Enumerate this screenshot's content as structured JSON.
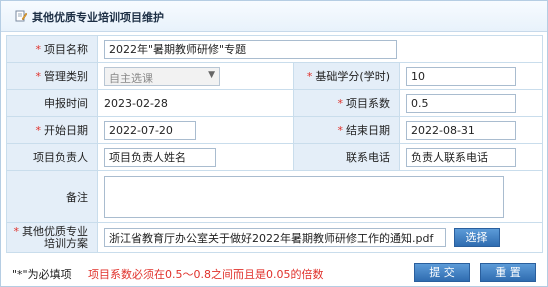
{
  "header": {
    "title": "其他优质专业培训项目维护"
  },
  "form": {
    "project_name": {
      "label": "项目名称",
      "value": "2022年\"暑期教师研修\"专题"
    },
    "management_category": {
      "label": "管理类别",
      "value": "自主选课"
    },
    "basic_credits": {
      "label": "基础学分(学时)",
      "value": "10"
    },
    "declare_time": {
      "label": "申报时间",
      "value": "2023-02-28"
    },
    "project_coefficient": {
      "label": "项目系数",
      "value": "0.5"
    },
    "start_date": {
      "label": "开始日期",
      "value": "2022-07-20"
    },
    "end_date": {
      "label": "结束日期",
      "value": "2022-08-31"
    },
    "project_leader": {
      "label": "项目负责人",
      "value": "项目负责人姓名"
    },
    "contact_phone": {
      "label": "联系电话",
      "value": "负责人联系电话"
    },
    "remarks": {
      "label": "备注",
      "value": ""
    },
    "training_plan": {
      "label_line1": "其他优质专业",
      "label_line2": "培训方案",
      "value": "浙江省教育厅办公室关于做好2022年暑期教师研修工作的通知.pdf",
      "select_button": "选择"
    }
  },
  "footer": {
    "required_note": "\"*\"为必填项",
    "coefficient_rule": "项目系数必须在0.5～0.8之间而且是0.05的倍数",
    "submit_label": "提 交",
    "reset_label": "重 置"
  },
  "icons": {
    "title_icon": "edit-document-icon"
  },
  "colors": {
    "required": "#e0312b",
    "label_bg": "#e4eef8",
    "button": "#3a78bd"
  }
}
